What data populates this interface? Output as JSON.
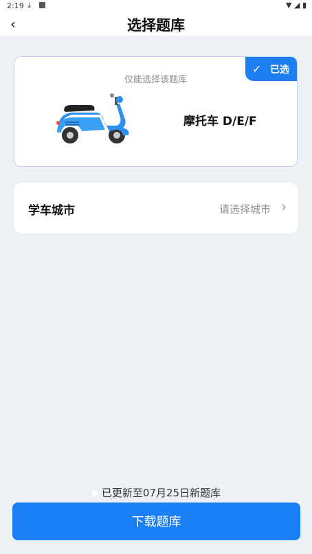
{
  "status_bar": {
    "time": "2:19",
    "icons": [
      "download-icon",
      "accessibility-icon",
      "wifi-icon",
      "signal-icon",
      "battery-icon"
    ]
  },
  "header": {
    "title": "选择题库",
    "back_icon": "chevron-left-icon"
  },
  "bank_card": {
    "hint": "仅能选择该题库",
    "badge": "已选",
    "name": "摩托车 D/E/F",
    "image": "blue-scooter-illustration"
  },
  "city_row": {
    "label": "学车城市",
    "value": "请选择城市"
  },
  "footer": {
    "update_text": "已更新至07月25日新题库",
    "download_button": "下载题库"
  },
  "colors": {
    "accent": "#1a7ff5",
    "background": "#edf0f4",
    "card": "#ffffff"
  }
}
